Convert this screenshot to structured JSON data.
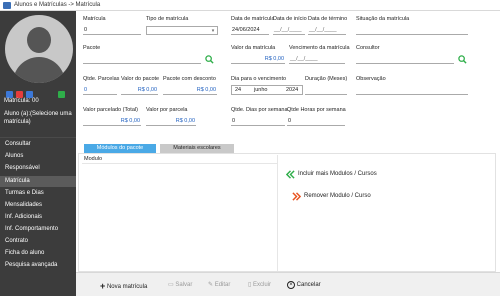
{
  "window": {
    "title": "Alunos e Matrículas -> Matrícula"
  },
  "sidebar": {
    "matricula_label": "Matrícula: 00",
    "aluno_label": "Aluno (a):(Selecione uma matrícula)",
    "square_colors": [
      "#3c78d8",
      "#e63c3c",
      "#3c78d8",
      "#2fae4a"
    ],
    "items": [
      {
        "label": "Consultar"
      },
      {
        "label": "Alunos"
      },
      {
        "label": "Responsável"
      },
      {
        "label": "Matrícula"
      },
      {
        "label": "Turmas e Dias"
      },
      {
        "label": "Mensalidades"
      },
      {
        "label": "Inf. Adicionais"
      },
      {
        "label": "Inf. Comportamento"
      },
      {
        "label": "Contrato"
      },
      {
        "label": "Ficha do aluno"
      },
      {
        "label": "Pesquisa avançada"
      }
    ]
  },
  "form": {
    "matricula": {
      "label": "Matrícula",
      "value": "0"
    },
    "tipo": {
      "label": "Tipo de matrícula",
      "value": ""
    },
    "data_matricula": {
      "label": "Data de matrícula",
      "value": "24/06/2024"
    },
    "data_inicio": {
      "label": "Data de início",
      "value": "__/__/____"
    },
    "data_termino": {
      "label": "Data de término",
      "value": "__/__/____"
    },
    "situacao": {
      "label": "Situação da matrícula",
      "value": ""
    },
    "pacote": {
      "label": "Pacote",
      "value": ""
    },
    "valor_matricula": {
      "label": "Valor da matrícula",
      "value": "R$ 0,00"
    },
    "vencimento_matricula": {
      "label": "Vencimento da matrícula",
      "value": "__/__/____"
    },
    "consultor": {
      "label": "Consultor",
      "value": ""
    },
    "qtde_parcelas": {
      "label": "Qtde. Parcelas",
      "value": "0"
    },
    "valor_pacote": {
      "label": "Valor do pacote",
      "value": "R$ 0,00"
    },
    "pacote_desconto": {
      "label": "Pacote com desconto",
      "value": "R$ 0,00"
    },
    "dia_vencimento": {
      "label": "Dia para o vencimento",
      "day": "24",
      "month": "junho",
      "year": "2024"
    },
    "duracao": {
      "label": "Duração (Meses)",
      "value": ""
    },
    "observacao": {
      "label": "Observação",
      "value": ""
    },
    "valor_parcelado": {
      "label": "Valor parcelado (Total)",
      "value": "R$ 0,00"
    },
    "valor_parcela": {
      "label": "Valor por parcela",
      "value": "R$ 0,00"
    },
    "qtde_dias": {
      "label": "Qtde. Dias por semana",
      "value": "0"
    },
    "qtde_horas": {
      "label": "Qtde Horas por semana",
      "value": "0"
    }
  },
  "tabs": [
    {
      "label": "Módulos do pacote",
      "active": true
    },
    {
      "label": "Materiais escolares",
      "active": false
    }
  ],
  "modules": {
    "column_header": "Modulo",
    "include_label": "Incluir mais Modulos / Cursos",
    "remove_label": "Remover Modulo / Curso"
  },
  "toolbar": {
    "new_label": "Nova matrícula",
    "save_label": "Salvar",
    "edit_label": "Editar",
    "delete_label": "Excluir",
    "cancel_label": "Cancelar"
  },
  "colors": {
    "sidebar_bg": "#3c3c3c",
    "tab_active": "#4aa9e6",
    "tab_inactive": "#c9c9c9",
    "include_icon": "#2fae4a",
    "remove_icon": "#e8531f",
    "value_blue": "#2060c0"
  }
}
